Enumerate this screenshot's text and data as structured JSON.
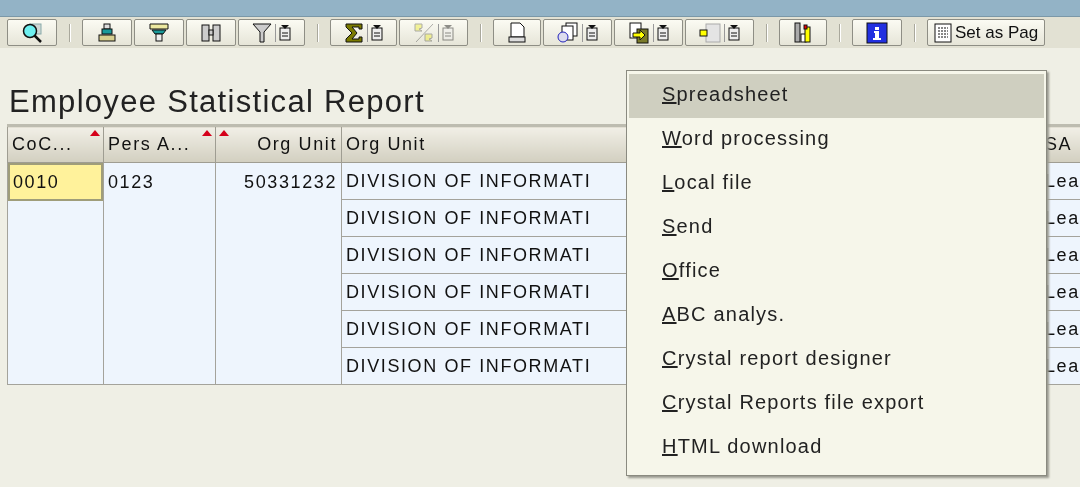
{
  "toolbar": {
    "groups": [
      [
        {
          "dropdown": false,
          "disabled": false
        }
      ],
      [
        {
          "dropdown": false,
          "disabled": false
        },
        {
          "dropdown": false,
          "disabled": false
        },
        {
          "dropdown": false,
          "disabled": false
        },
        {
          "dropdown": true,
          "disabled": false
        }
      ],
      [
        {
          "dropdown": true,
          "disabled": false
        },
        {
          "dropdown": true,
          "disabled": true
        }
      ],
      [
        {
          "dropdown": false,
          "disabled": false
        },
        {
          "dropdown": true,
          "disabled": false
        },
        {
          "dropdown": true,
          "disabled": false
        },
        {
          "dropdown": true,
          "disabled": false
        }
      ],
      [
        {
          "dropdown": false,
          "disabled": false
        }
      ],
      [
        {
          "dropdown": false,
          "disabled": false
        }
      ]
    ],
    "page_button": {
      "label": "Set as Pag"
    }
  },
  "title": "Employee Statistical Report",
  "table": {
    "columns": [
      {
        "label": "CoC...",
        "sorted": true,
        "kind": "text"
      },
      {
        "label": "Pers A...",
        "sorted": true,
        "kind": "text"
      },
      {
        "label": "Org Unit",
        "sorted": true,
        "kind": "number"
      },
      {
        "label": "Org Unit",
        "sorted": false,
        "kind": "text"
      },
      {
        "label": "SA",
        "sorted": false,
        "kind": "text"
      }
    ],
    "merged": [
      {
        "text": "0010",
        "selected": true
      },
      {
        "text": "0123",
        "selected": false
      },
      {
        "text": "50331232",
        "selected": false
      }
    ],
    "rows": [
      {
        "org_unit": "DIVISION OF INFORMATI",
        "column_5": "Lea"
      },
      {
        "org_unit": "DIVISION OF INFORMATI",
        "column_5": "Lea"
      },
      {
        "org_unit": "DIVISION OF INFORMATI",
        "column_5": "Lea"
      },
      {
        "org_unit": "DIVISION OF INFORMATI",
        "column_5": "Lea"
      },
      {
        "org_unit": "DIVISION OF INFORMATI",
        "column_5": "Lea"
      },
      {
        "org_unit": "DIVISION OF INFORMATI",
        "column_5": "Lea"
      }
    ]
  },
  "menu": {
    "items": [
      {
        "label": "Spreadsheet",
        "selected": true
      },
      {
        "label": "Word processing",
        "selected": false
      },
      {
        "label": "Local file",
        "selected": false
      },
      {
        "label": "Send",
        "selected": false
      },
      {
        "label": "Office",
        "selected": false
      },
      {
        "label": "ABC analys.",
        "selected": false
      },
      {
        "label": "Crystal report designer",
        "selected": false
      },
      {
        "label": "Crystal Reports file export",
        "selected": false
      },
      {
        "label": "HTML download",
        "selected": false
      }
    ]
  }
}
